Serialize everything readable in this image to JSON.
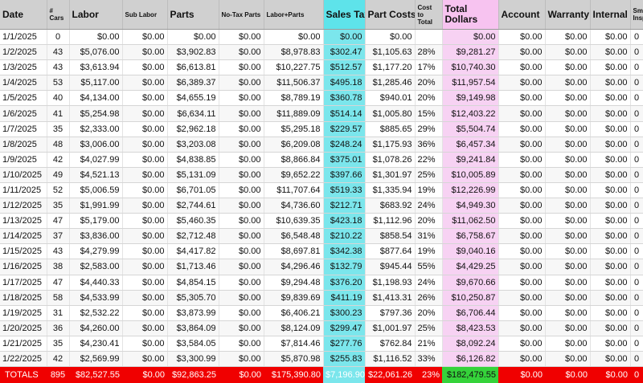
{
  "headers": {
    "date": "Date",
    "cars": "# Cars",
    "labor": "Labor",
    "sub_labor": "Sub Labor",
    "parts": "Parts",
    "no_tax_parts": "No-Tax Parts",
    "labor_parts": "Labor+Parts",
    "sales_tax": "Sales Tax",
    "part_costs": "Part Costs",
    "cost_to_total": "Cost to Total",
    "total_dollars": "Total Dollars",
    "account": "Account",
    "warranty": "Warranty",
    "internal": "Internal",
    "smog": "Smog Inspections"
  },
  "colors": {
    "header_bg": "#d0d0d0",
    "sales_tax_bg": "#7be6ec",
    "total_bg": "#f7d2f3",
    "totals_row_bg": "#f00000",
    "totals_total_bg": "#35d33a"
  },
  "rows": [
    [
      "1/1/2025",
      "0",
      "$0.00",
      "$0.00",
      "$0.00",
      "$0.00",
      "$0.00",
      "$0.00",
      "$0.00",
      "",
      "$0.00",
      "$0.00",
      "$0.00",
      "$0.00",
      "0"
    ],
    [
      "1/2/2025",
      "43",
      "$5,076.00",
      "$0.00",
      "$3,902.83",
      "$0.00",
      "$8,978.83",
      "$302.47",
      "$1,105.63",
      "28%",
      "$9,281.27",
      "$0.00",
      "$0.00",
      "$0.00",
      "0"
    ],
    [
      "1/3/2025",
      "43",
      "$3,613.94",
      "$0.00",
      "$6,613.81",
      "$0.00",
      "$10,227.75",
      "$512.57",
      "$1,177.20",
      "17%",
      "$10,740.30",
      "$0.00",
      "$0.00",
      "$0.00",
      "0"
    ],
    [
      "1/4/2025",
      "53",
      "$5,117.00",
      "$0.00",
      "$6,389.37",
      "$0.00",
      "$11,506.37",
      "$495.18",
      "$1,285.46",
      "20%",
      "$11,957.54",
      "$0.00",
      "$0.00",
      "$0.00",
      "0"
    ],
    [
      "1/5/2025",
      "40",
      "$4,134.00",
      "$0.00",
      "$4,655.19",
      "$0.00",
      "$8,789.19",
      "$360.78",
      "$940.01",
      "20%",
      "$9,149.98",
      "$0.00",
      "$0.00",
      "$0.00",
      "0"
    ],
    [
      "1/6/2025",
      "41",
      "$5,254.98",
      "$0.00",
      "$6,634.11",
      "$0.00",
      "$11,889.09",
      "$514.14",
      "$1,005.80",
      "15%",
      "$12,403.22",
      "$0.00",
      "$0.00",
      "$0.00",
      "0"
    ],
    [
      "1/7/2025",
      "35",
      "$2,333.00",
      "$0.00",
      "$2,962.18",
      "$0.00",
      "$5,295.18",
      "$229.57",
      "$885.65",
      "29%",
      "$5,504.74",
      "$0.00",
      "$0.00",
      "$0.00",
      "0"
    ],
    [
      "1/8/2025",
      "48",
      "$3,006.00",
      "$0.00",
      "$3,203.08",
      "$0.00",
      "$6,209.08",
      "$248.24",
      "$1,175.93",
      "36%",
      "$6,457.34",
      "$0.00",
      "$0.00",
      "$0.00",
      "0"
    ],
    [
      "1/9/2025",
      "42",
      "$4,027.99",
      "$0.00",
      "$4,838.85",
      "$0.00",
      "$8,866.84",
      "$375.01",
      "$1,078.26",
      "22%",
      "$9,241.84",
      "$0.00",
      "$0.00",
      "$0.00",
      "0"
    ],
    [
      "1/10/2025",
      "49",
      "$4,521.13",
      "$0.00",
      "$5,131.09",
      "$0.00",
      "$9,652.22",
      "$397.66",
      "$1,301.97",
      "25%",
      "$10,005.89",
      "$0.00",
      "$0.00",
      "$0.00",
      "0"
    ],
    [
      "1/11/2025",
      "52",
      "$5,006.59",
      "$0.00",
      "$6,701.05",
      "$0.00",
      "$11,707.64",
      "$519.33",
      "$1,335.94",
      "19%",
      "$12,226.99",
      "$0.00",
      "$0.00",
      "$0.00",
      "0"
    ],
    [
      "1/12/2025",
      "35",
      "$1,991.99",
      "$0.00",
      "$2,744.61",
      "$0.00",
      "$4,736.60",
      "$212.71",
      "$683.92",
      "24%",
      "$4,949.30",
      "$0.00",
      "$0.00",
      "$0.00",
      "0"
    ],
    [
      "1/13/2025",
      "47",
      "$5,179.00",
      "$0.00",
      "$5,460.35",
      "$0.00",
      "$10,639.35",
      "$423.18",
      "$1,112.96",
      "20%",
      "$11,062.50",
      "$0.00",
      "$0.00",
      "$0.00",
      "0"
    ],
    [
      "1/14/2025",
      "37",
      "$3,836.00",
      "$0.00",
      "$2,712.48",
      "$0.00",
      "$6,548.48",
      "$210.22",
      "$858.54",
      "31%",
      "$6,758.67",
      "$0.00",
      "$0.00",
      "$0.00",
      "0"
    ],
    [
      "1/15/2025",
      "43",
      "$4,279.99",
      "$0.00",
      "$4,417.82",
      "$0.00",
      "$8,697.81",
      "$342.38",
      "$877.64",
      "19%",
      "$9,040.16",
      "$0.00",
      "$0.00",
      "$0.00",
      "0"
    ],
    [
      "1/16/2025",
      "38",
      "$2,583.00",
      "$0.00",
      "$1,713.46",
      "$0.00",
      "$4,296.46",
      "$132.79",
      "$945.44",
      "55%",
      "$4,429.25",
      "$0.00",
      "$0.00",
      "$0.00",
      "0"
    ],
    [
      "1/17/2025",
      "47",
      "$4,440.33",
      "$0.00",
      "$4,854.15",
      "$0.00",
      "$9,294.48",
      "$376.20",
      "$1,198.93",
      "24%",
      "$9,670.66",
      "$0.00",
      "$0.00",
      "$0.00",
      "0"
    ],
    [
      "1/18/2025",
      "58",
      "$4,533.99",
      "$0.00",
      "$5,305.70",
      "$0.00",
      "$9,839.69",
      "$411.19",
      "$1,413.31",
      "26%",
      "$10,250.87",
      "$0.00",
      "$0.00",
      "$0.00",
      "0"
    ],
    [
      "1/19/2025",
      "31",
      "$2,532.22",
      "$0.00",
      "$3,873.99",
      "$0.00",
      "$6,406.21",
      "$300.23",
      "$797.36",
      "20%",
      "$6,706.44",
      "$0.00",
      "$0.00",
      "$0.00",
      "0"
    ],
    [
      "1/20/2025",
      "36",
      "$4,260.00",
      "$0.00",
      "$3,864.09",
      "$0.00",
      "$8,124.09",
      "$299.47",
      "$1,001.97",
      "25%",
      "$8,423.53",
      "$0.00",
      "$0.00",
      "$0.00",
      "0"
    ],
    [
      "1/21/2025",
      "35",
      "$4,230.41",
      "$0.00",
      "$3,584.05",
      "$0.00",
      "$7,814.46",
      "$277.76",
      "$762.84",
      "21%",
      "$8,092.24",
      "$0.00",
      "$0.00",
      "$0.00",
      "0"
    ],
    [
      "1/22/2025",
      "42",
      "$2,569.99",
      "$0.00",
      "$3,300.99",
      "$0.00",
      "$5,870.98",
      "$255.83",
      "$1,116.52",
      "33%",
      "$6,126.82",
      "$0.00",
      "$0.00",
      "$0.00",
      "0"
    ]
  ],
  "totals": [
    "TOTALS",
    "895",
    "$82,527.55",
    "$0.00",
    "$92,863.25",
    "$0.00",
    "$175,390.80",
    "$7,196.90",
    "$22,061.26",
    "23%",
    "$182,479.55",
    "$0.00",
    "$0.00",
    "$0.00",
    "0"
  ]
}
